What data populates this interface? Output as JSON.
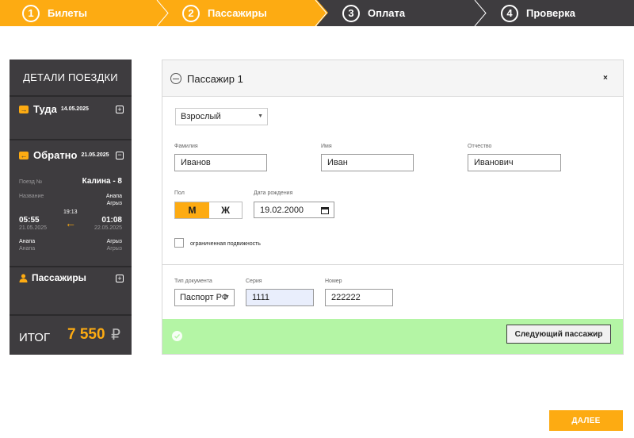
{
  "steps": [
    {
      "num": "1",
      "label": "Билеты"
    },
    {
      "num": "2",
      "label": "Пассажиры"
    },
    {
      "num": "3",
      "label": "Оплата"
    },
    {
      "num": "4",
      "label": "Проверка"
    }
  ],
  "sidebar": {
    "title": "ДЕТАЛИ ПОЕЗДКИ",
    "outbound": {
      "label": "Туда",
      "date": "14.05.2025"
    },
    "return": {
      "label": "Обратно",
      "date": "21.05.2025",
      "train_no_label": "Поезд №",
      "train_name": "Калина - 8",
      "name_label": "Название",
      "route_from": "Анапа",
      "route_to": "Агрыз",
      "dep_time": "05:55",
      "dep_date": "21.05.2025",
      "duration": "19:13",
      "arr_time": "01:08",
      "arr_date": "22.05.2025",
      "dep_city": "Анапа",
      "dep_station": "Анапа",
      "arr_city": "Агрыз",
      "arr_station": "Агрыз"
    },
    "passengers_label": "Пассажиры",
    "total_label": "ИТОГ",
    "total_value": "7 550",
    "currency": "₽"
  },
  "passenger": {
    "title": "Пассажир 1",
    "close": "×",
    "type": "Взрослый",
    "surname_label": "Фамилия",
    "surname": "Иванов",
    "name_label": "Имя",
    "name": "Иван",
    "patronymic_label": "Отчество",
    "patronymic": "Иванович",
    "gender_label": "Пол",
    "male": "М",
    "female": "Ж",
    "birth_label": "Дата рождения",
    "birth": "19.02.2000",
    "mobility_label": "ограниченная подвижность",
    "doc_type_label": "Тип документа",
    "doc_type": "Паспорт РФ",
    "series_label": "Серия",
    "series": "1111",
    "number_label": "Номер",
    "number": "222222",
    "next_label": "Следующий пассажир"
  },
  "next_button": "ДАЛЕЕ",
  "colors": {
    "accent": "#fdab12",
    "dark": "#3e3c3f",
    "success": "#b4f5a5"
  }
}
